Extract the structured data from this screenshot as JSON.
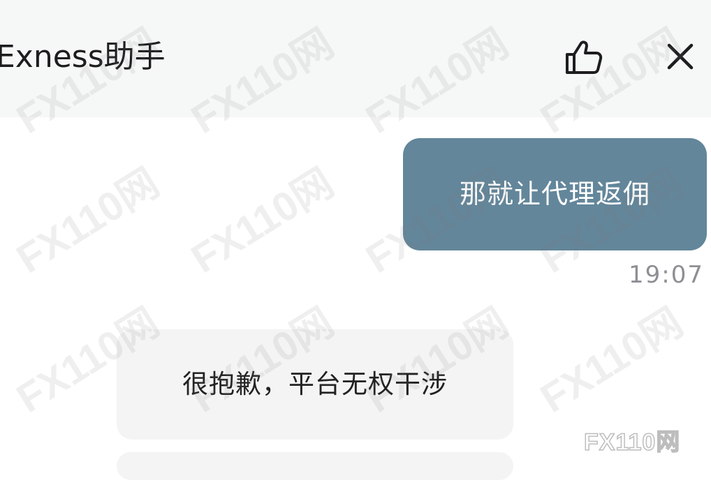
{
  "header": {
    "title": "Exness助手"
  },
  "icons": {
    "like": "thumbs-up-icon",
    "close": "close-icon"
  },
  "messages": [
    {
      "from": "user",
      "text": "那就让代理返佣",
      "time": "19:07"
    },
    {
      "from": "assistant",
      "text": "很抱歉，平台无权干涉"
    }
  ],
  "watermark": {
    "text": "FX110网"
  },
  "colors": {
    "header_bg": "#f6f7f7",
    "outgoing_bubble": "#63869a",
    "incoming_bubble": "#f4f4f5",
    "timestamp": "#8d8f94"
  }
}
